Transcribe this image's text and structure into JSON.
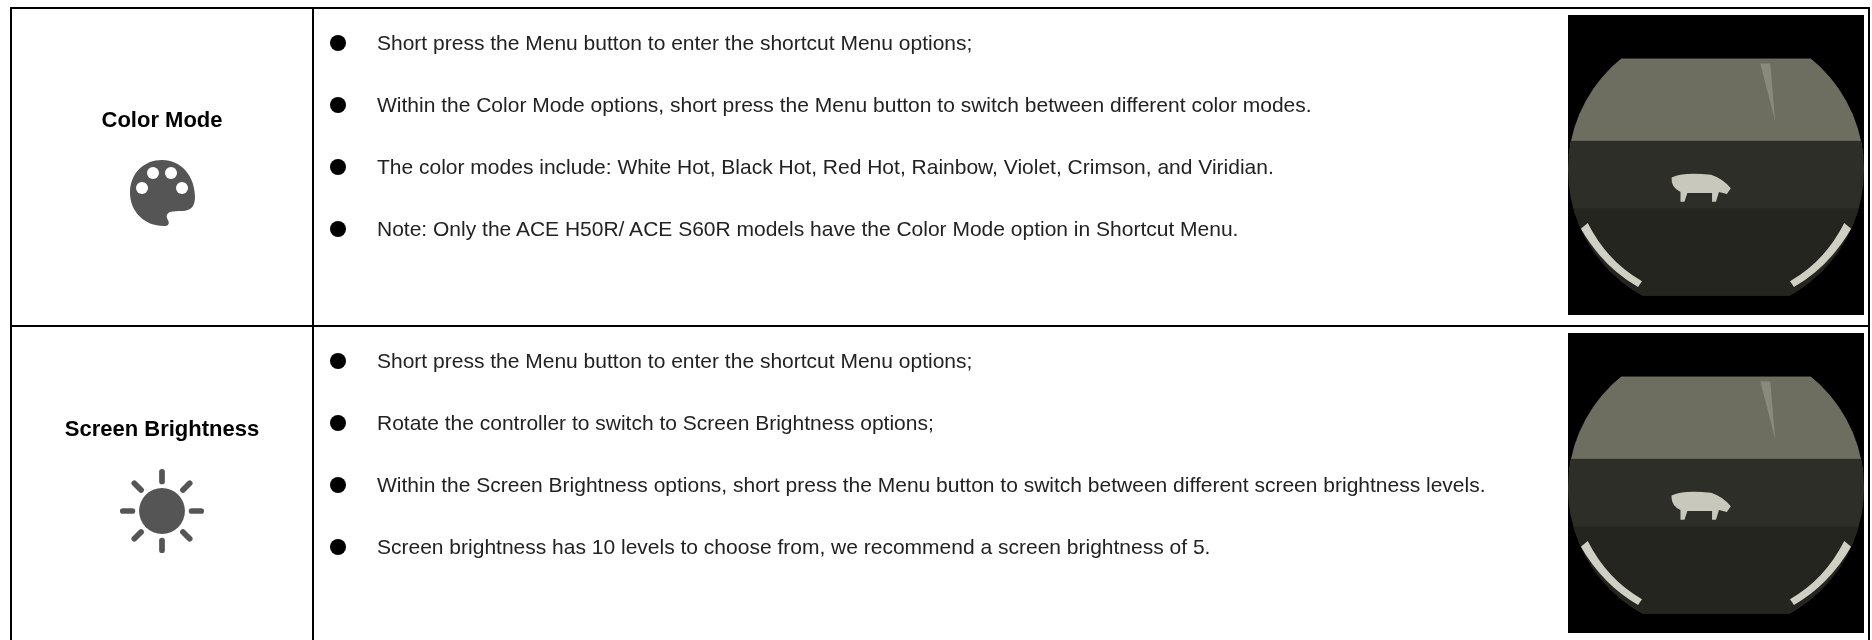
{
  "table": {
    "rows": [
      {
        "title": "Color Mode",
        "bullets": [
          "Short press the Menu button to enter the shortcut Menu options;",
          "Within the Color Mode options, short press the Menu button to switch between different color modes.",
          "The color modes include: White Hot, Black Hot, Red Hot, Rainbow, Violet, Crimson, and Viridian.",
          "Note: Only the ACE H50R/ ACE S60R models have the Color Mode option in Shortcut Menu."
        ]
      },
      {
        "title": "Screen Brightness",
        "bullets": [
          "Short press the Menu button to enter the shortcut Menu options;",
          "Rotate the controller to switch to Screen Brightness options;",
          "Within the Screen Brightness options, short press the Menu button to switch between different screen brightness levels.",
          "Screen brightness has 10 levels to choose from, we recommend a screen brightness of 5."
        ]
      }
    ]
  }
}
